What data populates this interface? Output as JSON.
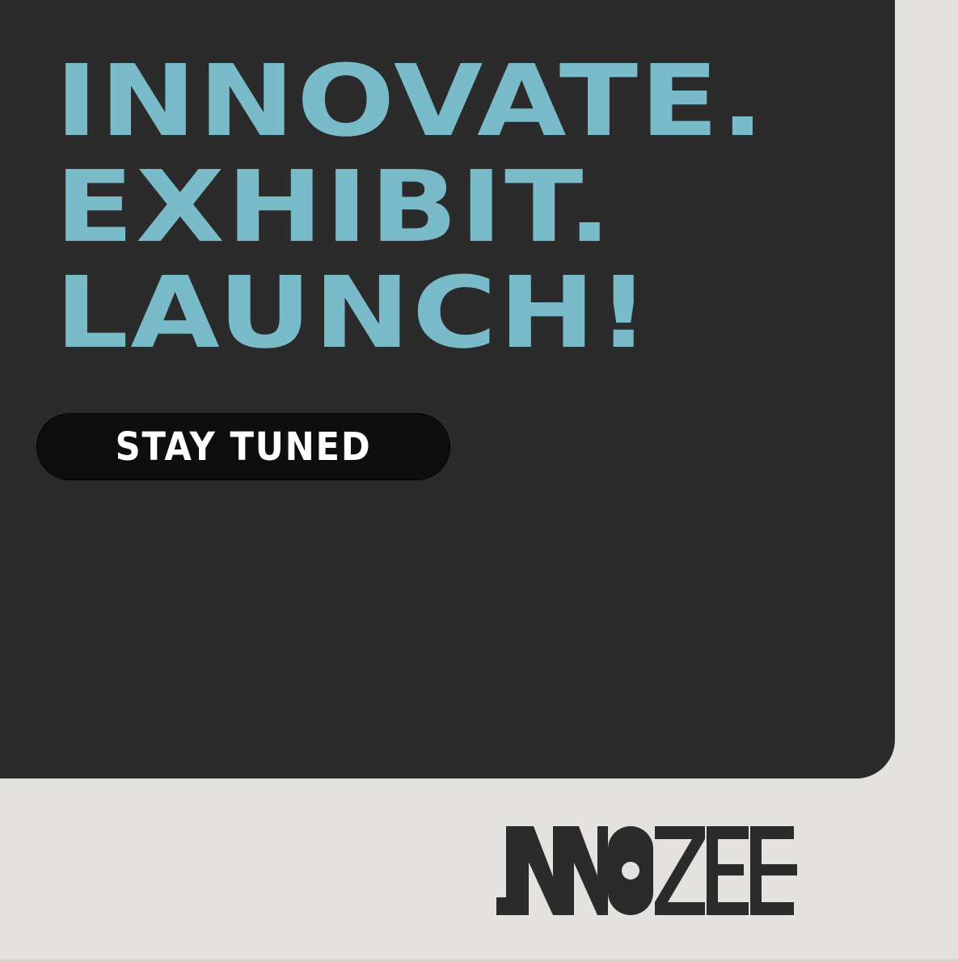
{
  "headline": {
    "line1": "INNOVATE.",
    "line2": "EXHIBIT.",
    "line3": "LAUNCH!"
  },
  "cta": {
    "label": "STAY TUNED"
  },
  "logo": {
    "text": "INNOZEE",
    "icon": "innozee-wordmark-icon"
  },
  "colors": {
    "panel": "#2b2b2b",
    "background": "#e3e2de",
    "accent": "#79bbc9",
    "button": "#0e0e0e",
    "logo": "#2b2b2b"
  }
}
